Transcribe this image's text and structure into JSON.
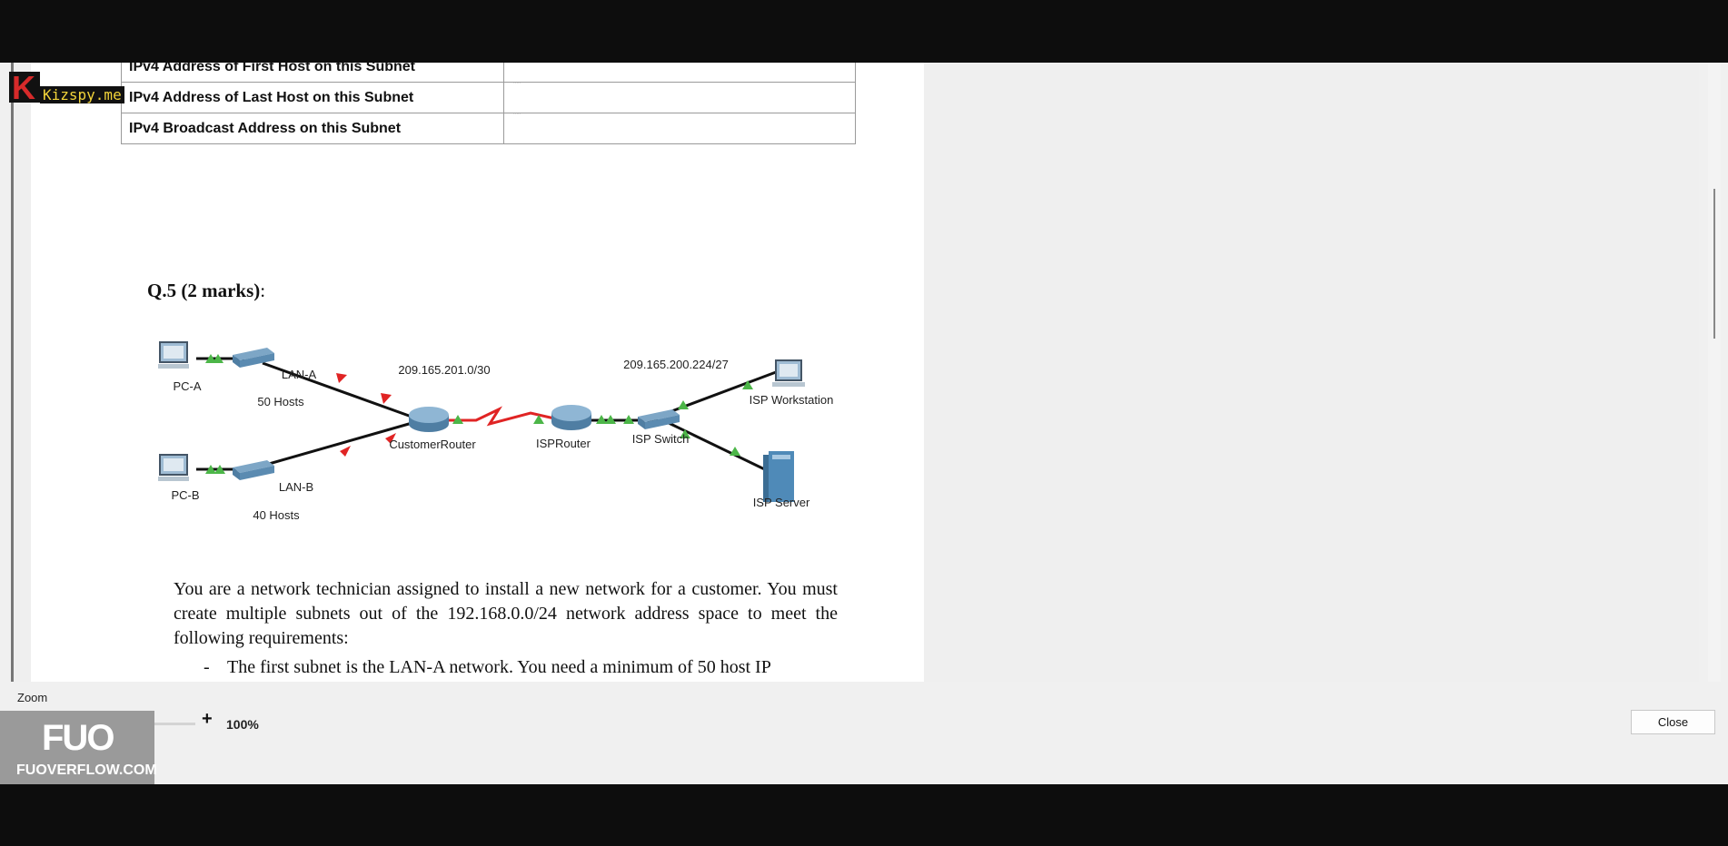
{
  "document": {
    "table_rows": [
      {
        "label": "IPv4 Address of First Host on this Subnet",
        "value": ""
      },
      {
        "label": "IPv4 Address of Last Host on this Subnet",
        "value": ""
      },
      {
        "label": "IPv4 Broadcast Address on this Subnet",
        "value": ""
      }
    ],
    "question_title": "Q.5 (2 marks)",
    "question_colon": ":",
    "paragraph": "You are a network technician assigned to install a new network for a customer. You must create multiple subnets out of the 192.168.0.0/24 network address space to meet the following requirements:",
    "bullet": "The first subnet is the LAN-A network. You need a minimum of 50 host IP",
    "bullet_dash": "-"
  },
  "diagram": {
    "pc_a": "PC-A",
    "lan_a": "LAN-A",
    "lan_a_hosts": "50 Hosts",
    "pc_b": "PC-B",
    "lan_b": "LAN-B",
    "lan_b_hosts": "40 Hosts",
    "customer_router": "CustomerRouter",
    "isp_router": "ISPRouter",
    "isp_switch": "ISP Switch",
    "isp_workstation": "ISP Workstation",
    "isp_server": "ISP Server",
    "link_customer_isp": "209.165.201.0/30",
    "link_isp_lan": "209.165.200.224/27"
  },
  "controls": {
    "zoom_label": "Zoom",
    "zoom_minus": "-",
    "zoom_plus": "+",
    "zoom_value": "100%",
    "zoom_level_percent": 100,
    "close_label": "Close"
  },
  "watermarks": {
    "fuo_logo": "FUO",
    "fuo_site": "FUOVERFLOW.COM",
    "kizspy_logo": "K",
    "kizspy_text": "Kizspy.me"
  },
  "colors": {
    "link_red": "#e02424",
    "link_green_marker": "#4cb648",
    "device_blue": "#4f8ab8",
    "zoom_thumb": "#1f5aa8"
  }
}
